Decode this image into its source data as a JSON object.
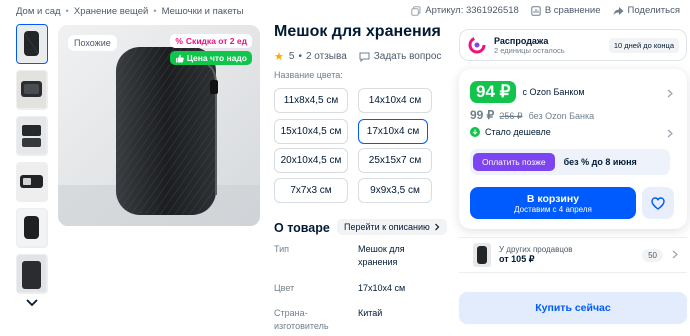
{
  "breadcrumbs": [
    "Дом и сад",
    "Хранение вещей",
    "Мешочки и пакеты"
  ],
  "meta": {
    "article": "Артикул: 3361926518",
    "compare": "В сравнение",
    "share": "Поделиться"
  },
  "gallery": {
    "similar_label": "Похожие",
    "discount_badge": "Скидка от 2 ед",
    "good_price_badge": "Цена что надо"
  },
  "product": {
    "title": "Мешок для хранения",
    "rating": "5",
    "reviews": "2 отзыва",
    "ask": "Задать вопрос",
    "color_label": "Название цвета:",
    "sizes": [
      {
        "label": "11x8x4,5 см",
        "selected": false
      },
      {
        "label": "14x10x4 см",
        "selected": false
      },
      {
        "label": "15x10x4,5 см",
        "selected": false
      },
      {
        "label": "17x10x4 см",
        "selected": true
      },
      {
        "label": "20x10x4,5 см",
        "selected": false
      },
      {
        "label": "25x15x7 см",
        "selected": false
      },
      {
        "label": "7x7x3 см",
        "selected": false
      },
      {
        "label": "9x9x3,5 см",
        "selected": false
      }
    ],
    "about_title": "О товаре",
    "about_link": "Перейти к описанию",
    "specs": [
      {
        "key": "Тип",
        "value": "Мешок для хранения"
      },
      {
        "key": "Цвет",
        "value": "17x10x4 см"
      },
      {
        "key": "Страна-изготовитель",
        "value": "Китай"
      }
    ]
  },
  "sale": {
    "name": "Распродажа",
    "sub": "2 единицы осталось",
    "days": "10 дней до конца"
  },
  "price": {
    "ozon_price": "94 ₽",
    "ozon_label": "с Ozon Банком",
    "regular_price": "99 ₽",
    "old_price": "256 ₽",
    "regular_label": "без Ozon Банка",
    "cheaper": "Стало дешевле",
    "installment_button": "Оплатить позже",
    "installment_text": "без % до 8 июня",
    "cart_label": "В корзину",
    "cart_sub": "Доставим с 4 апреля"
  },
  "other_sellers": {
    "label": "У других продавцов",
    "price": "от 105 ₽",
    "count": "50"
  },
  "buy_now": "Купить сейчас",
  "colors": {
    "accent": "#005bff",
    "green": "#10c44c",
    "pink": "#f1117e",
    "purple": "#7d45f2"
  }
}
